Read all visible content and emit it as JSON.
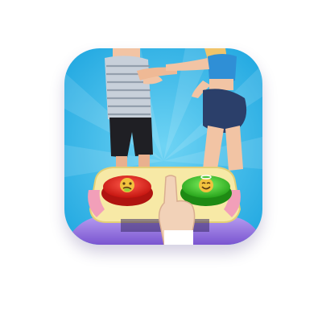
{
  "app_icon": {
    "icons": [
      "man-character-icon",
      "woman-character-icon",
      "red-sick-emoji-button-icon",
      "green-happy-emoji-button-icon",
      "pointing-hand-icon"
    ],
    "colors": {
      "background": "#2fb6ea",
      "background_light": "#6fd4f4",
      "button_red": "#e2261f",
      "button_green": "#3cc32e",
      "console_yellow": "#f7e9a6",
      "console_purple": "#8a6bd6"
    }
  }
}
